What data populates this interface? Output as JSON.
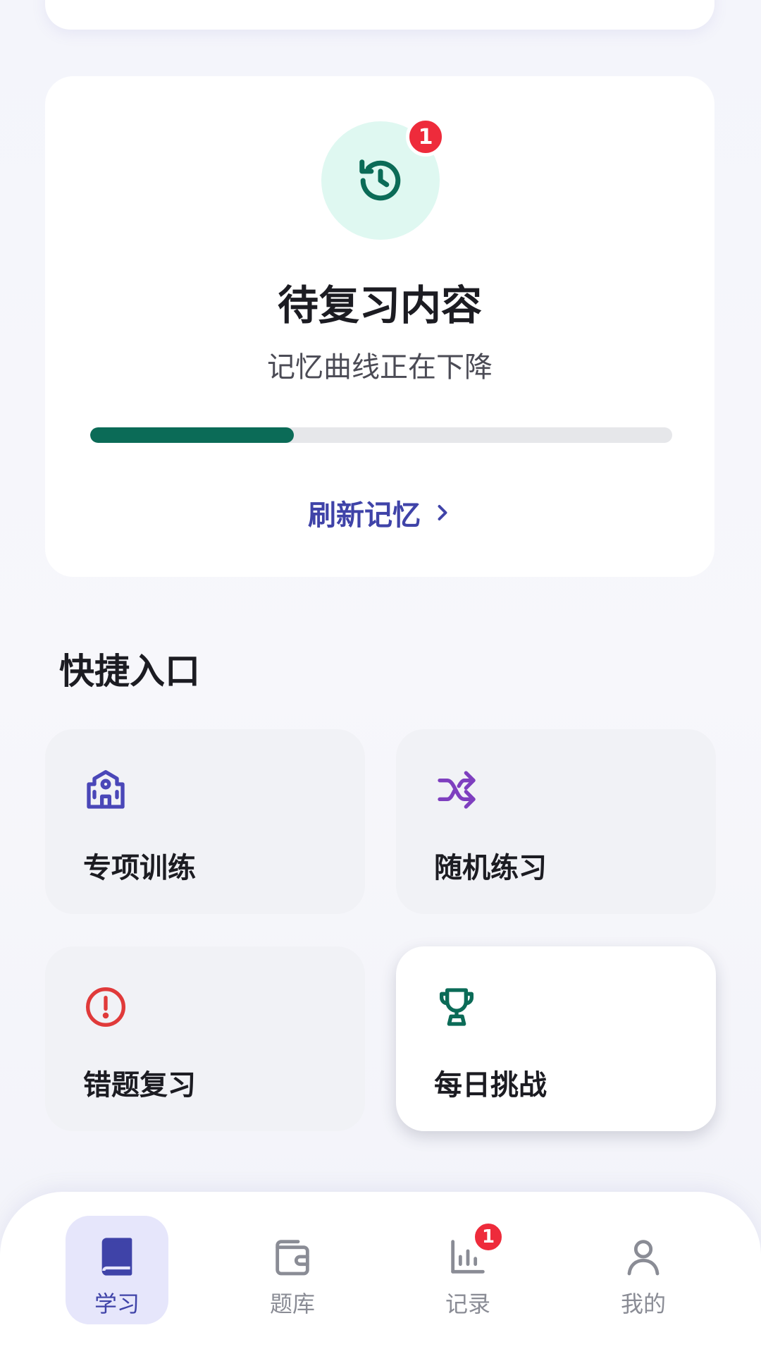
{
  "review": {
    "badge_count": "1",
    "title": "待复习内容",
    "subtitle": "记忆曲线正在下降",
    "progress_fraction": 0.35,
    "action_label": "刷新记忆",
    "icon": "history-icon"
  },
  "quick_access": {
    "title": "快捷入口",
    "items": [
      {
        "label": "专项训练",
        "icon": "school-icon",
        "color": "#4a47b8"
      },
      {
        "label": "随机练习",
        "icon": "shuffle-icon",
        "color": "#7e3fbf"
      },
      {
        "label": "错题复习",
        "icon": "alert-circle-icon",
        "color": "#e03a3a"
      },
      {
        "label": "每日挑战",
        "icon": "trophy-icon",
        "color": "#0b6b57"
      }
    ]
  },
  "nav": {
    "items": [
      {
        "label": "学习",
        "icon": "book-icon",
        "active": true
      },
      {
        "label": "题库",
        "icon": "wallet-icon",
        "active": false
      },
      {
        "label": "记录",
        "icon": "bar-chart-icon",
        "active": false,
        "badge": "1"
      },
      {
        "label": "我的",
        "icon": "person-icon",
        "active": false
      }
    ]
  },
  "colors": {
    "accent": "#3f43a8",
    "teal": "#0b6b57",
    "badge": "#ee2b3b"
  }
}
